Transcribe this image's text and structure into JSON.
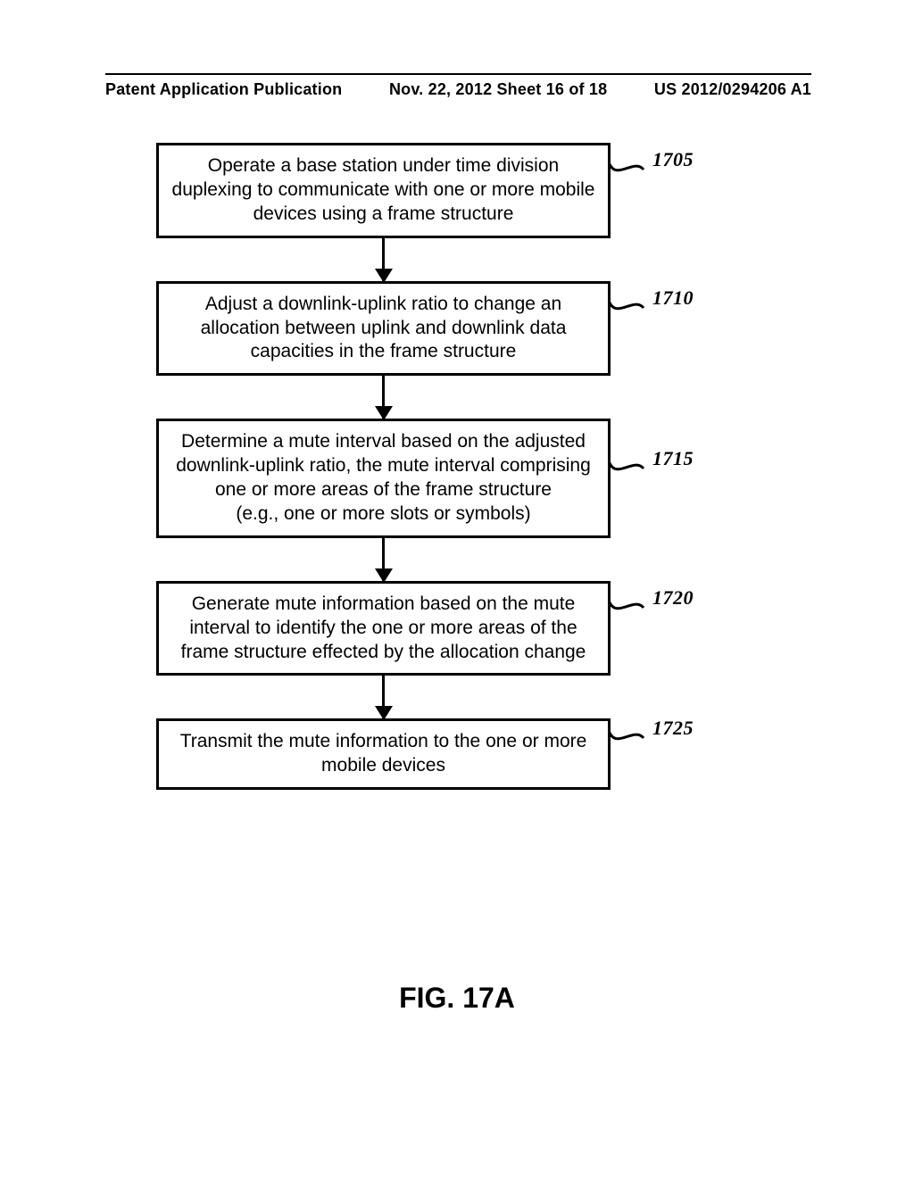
{
  "header": {
    "left": "Patent Application Publication",
    "middle": "Nov. 22, 2012  Sheet 16 of 18",
    "right": "US 2012/0294206 A1"
  },
  "steps": [
    {
      "ref": "1705",
      "text": "Operate a base station under time division duplexing to communicate with one or more mobile devices using a frame structure"
    },
    {
      "ref": "1710",
      "text": "Adjust a downlink-uplink ratio to change an allocation between uplink and downlink data capacities in the frame structure"
    },
    {
      "ref": "1715",
      "text": "Determine a mute interval based on the adjusted downlink-uplink ratio, the mute interval comprising one or more areas of the frame structure\n(e.g., one or more slots or symbols)"
    },
    {
      "ref": "1720",
      "text": "Generate mute information based on the mute interval to identify the one or more areas of the frame structure effected by the allocation change"
    },
    {
      "ref": "1725",
      "text": "Transmit the mute information to the one or more mobile devices"
    }
  ],
  "figure_label": "FIG. 17A"
}
